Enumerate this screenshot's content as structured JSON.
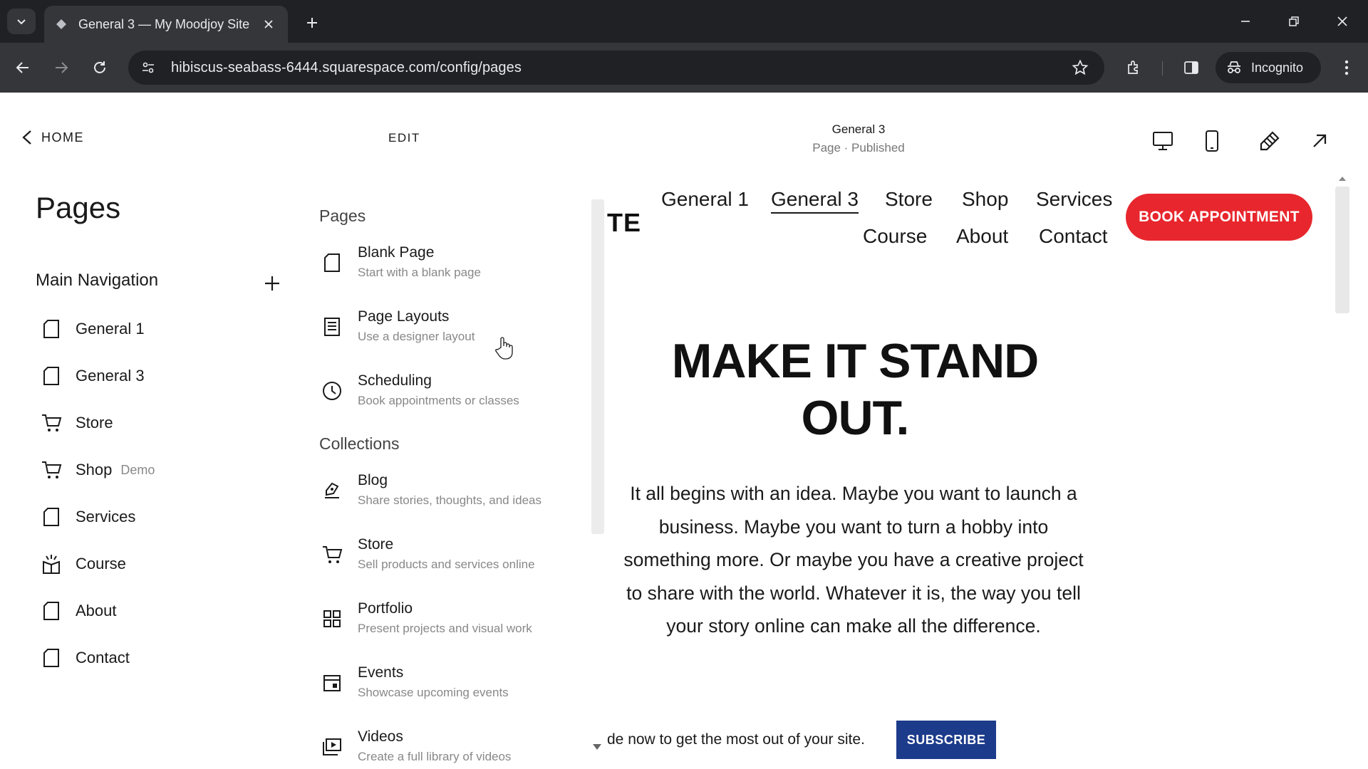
{
  "browser": {
    "tab_title": "General 3 — My Moodjoy Site",
    "url": "hibiscus-seabass-6444.squarespace.com/config/pages",
    "incognito_label": "Incognito"
  },
  "header": {
    "home_label": "HOME",
    "edit_label": "EDIT",
    "page_name": "General 3",
    "page_status": "Page · Published"
  },
  "sidebar": {
    "title": "Pages",
    "nav_heading": "Main Navigation",
    "items": [
      {
        "label": "General 1",
        "badge": "",
        "icon": "page-icon"
      },
      {
        "label": "General 3",
        "badge": "",
        "icon": "page-icon"
      },
      {
        "label": "Store",
        "badge": "",
        "icon": "cart-icon"
      },
      {
        "label": "Shop",
        "badge": "Demo",
        "icon": "cart-icon"
      },
      {
        "label": "Services",
        "badge": "",
        "icon": "page-icon"
      },
      {
        "label": "Course",
        "badge": "",
        "icon": "course-icon"
      },
      {
        "label": "About",
        "badge": "",
        "icon": "page-icon"
      },
      {
        "label": "Contact",
        "badge": "",
        "icon": "page-icon"
      }
    ]
  },
  "add_panel": {
    "pages_heading": "Pages",
    "pages": [
      {
        "title": "Blank Page",
        "desc": "Start with a blank page",
        "icon": "blank-page-icon"
      },
      {
        "title": "Page Layouts",
        "desc": "Use a designer layout",
        "icon": "layout-icon"
      },
      {
        "title": "Scheduling",
        "desc": "Book appointments or classes",
        "icon": "clock-icon"
      }
    ],
    "collections_heading": "Collections",
    "collections": [
      {
        "title": "Blog",
        "desc": "Share stories, thoughts, and ideas",
        "icon": "blog-icon"
      },
      {
        "title": "Store",
        "desc": "Sell products and services online",
        "icon": "cart-icon"
      },
      {
        "title": "Portfolio",
        "desc": "Present projects and visual work",
        "icon": "grid-icon"
      },
      {
        "title": "Events",
        "desc": "Showcase upcoming events",
        "icon": "calendar-icon"
      },
      {
        "title": "Videos",
        "desc": "Create a full library of videos",
        "icon": "video-icon"
      }
    ]
  },
  "preview": {
    "logo_fragment": "TE",
    "nav": [
      "General 1",
      "General 3",
      "Store",
      "Shop",
      "Services",
      "Course",
      "About",
      "Contact"
    ],
    "active_nav": "General 3",
    "book_button": "BOOK APPOINTMENT",
    "hero_line1": "MAKE IT STAND",
    "hero_line2": "OUT.",
    "body": "It all begins with an idea. Maybe you want to launch a business. Maybe you want to turn a hobby into something more. Or maybe you have a creative project to share with the world. Whatever it is, the way you tell your story online can make all the difference.",
    "footer_text": "de now to get the most out of your site.",
    "subscribe_button": "SUBSCRIBE",
    "colors": {
      "accent": "#e8262d",
      "subscribe": "#1d3b8b"
    }
  }
}
